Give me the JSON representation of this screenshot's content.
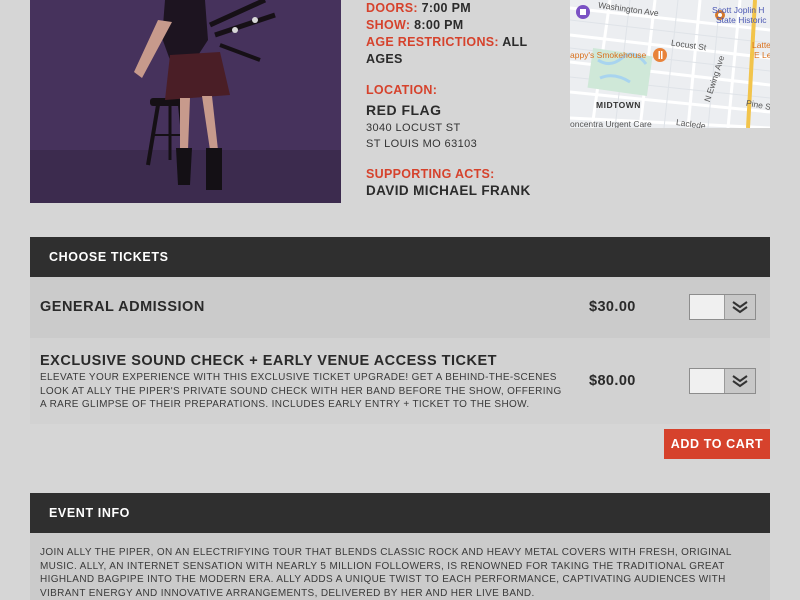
{
  "event": {
    "doors_label": "Doors:",
    "doors_time": "7:00 PM",
    "show_label": "Show:",
    "show_time": "8:00 PM",
    "age_label": "Age Restrictions:",
    "age_value": "All Ages",
    "location_label": "Location:",
    "venue_name": "Red Flag",
    "address_line1": "3040 Locust St",
    "address_line2": "St Louis MO 63103",
    "supporting_label": "Supporting Acts:",
    "supporting_act": "David Michael Frank"
  },
  "map": {
    "labels": {
      "washington_ave": "Washington Ave",
      "scott_joplin_1": "Scott Joplin H",
      "scott_joplin_2": "State Historic",
      "smokehouse": "appy's Smokehouse",
      "locust_st": "Locust St",
      "latte_1": "Latte",
      "latte_2": "E Let",
      "midtown": "MIDTOWN",
      "n_ewing": "N Ewing Ave",
      "pine_st": "Pine St",
      "concentra": "oncentra Urgent Care",
      "laclede": "Laclede"
    }
  },
  "tickets": {
    "header": "Choose Tickets",
    "items": [
      {
        "name": "General Admission",
        "description": "",
        "price": "$30.00"
      },
      {
        "name": "Exclusive Sound Check + Early Venue Access Ticket",
        "description": "Elevate your experience with this exclusive ticket upgrade! Get a behind-the-scenes look at Ally the Piper's private sound check with her band before the show, offering a rare glimpse of their preparations. Includes early entry + ticket to the show.",
        "price": "$80.00"
      }
    ],
    "add_to_cart": "Add to Cart"
  },
  "event_info": {
    "header": "Event Info",
    "body": "Join Ally the Piper, on an electrifying tour that blends classic rock and heavy metal covers with fresh, original music. Ally, an internet sensation with nearly 5 million followers, is renowned for taking the traditional Great Highland bagpipe into the modern era. Ally adds a unique twist to each performance, captivating audiences with vibrant energy and innovative arrangements, delivered by her and her live band."
  },
  "colors": {
    "accent": "#d6422c",
    "header_bg": "#2f2f2f",
    "page_bg": "#d6d6d6"
  },
  "icons": {
    "quantity_dropdown": "chevron-down-double-icon",
    "map_landmark": "landmark-icon",
    "map_restaurant": "restaurant-icon"
  }
}
